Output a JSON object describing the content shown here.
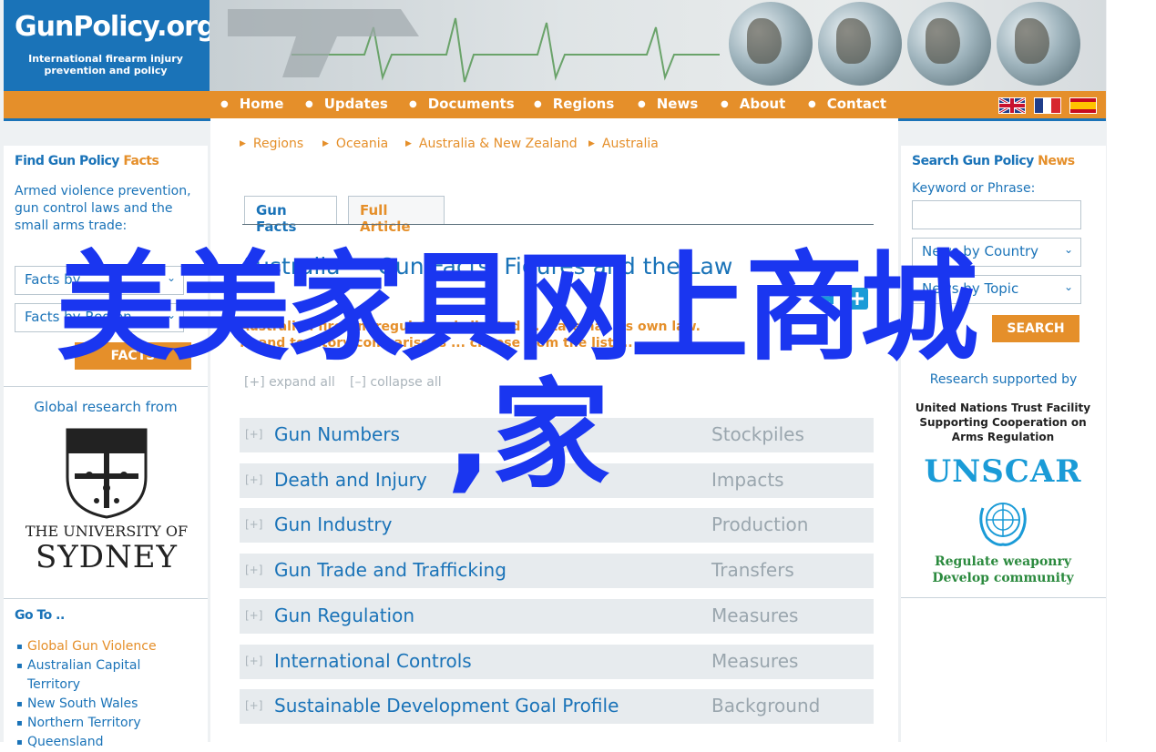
{
  "header": {
    "logo_title": "GunPolicy.org",
    "logo_sub_1": "International firearm injury",
    "logo_sub_2": "prevention and policy"
  },
  "nav": {
    "items": [
      "Home",
      "Updates",
      "Documents",
      "Regions",
      "News",
      "About",
      "Contact"
    ],
    "flags": [
      "uk-flag",
      "france-flag",
      "spain-flag"
    ]
  },
  "left": {
    "find_title_a": "Find Gun Policy",
    "find_title_b": "Facts",
    "find_text": "Armed violence prevention, gun control laws and the small arms trade:",
    "select_facts_by": "Facts by",
    "select_facts_region": "Facts by Region",
    "facts_button": "FACTS",
    "global_research": "Global research from",
    "uni_line1": "THE UNIVERSITY OF",
    "uni_line2": "SYDNEY",
    "goto_title": "Go To ..",
    "goto_items": [
      "Global Gun Violence",
      "Australian Capital Territory",
      "New South Wales",
      "Northern Territory",
      "Queensland"
    ]
  },
  "main": {
    "breadcrumbs": [
      "Regions",
      "Oceania",
      "Australia & New Zealand",
      "Australia"
    ],
    "tabs": [
      "Gun Facts",
      "Full Article"
    ],
    "title": "Australia — Gun Facts, Figures and the Law",
    "intro_1": "Australian firearm regulation is limited ... state has its own law.",
    "intro_2": "... and territory comparisons ... choose from the list ...",
    "expand_all": "[+] expand all",
    "collapse_all": "[–] collapse all",
    "rows": [
      {
        "title": "Gun Numbers",
        "sub": "Stockpiles"
      },
      {
        "title": "Death and Injury",
        "sub": "Impacts"
      },
      {
        "title": "Gun Industry",
        "sub": "Production"
      },
      {
        "title": "Gun Trade and Trafficking",
        "sub": "Transfers"
      },
      {
        "title": "Gun Regulation",
        "sub": "Measures"
      },
      {
        "title": "International Controls",
        "sub": "Measures"
      },
      {
        "title": "Sustainable Development Goal Profile",
        "sub": "Background"
      }
    ],
    "row_plus": "[+]"
  },
  "right": {
    "search_title_a": "Search Gun Policy",
    "search_title_b": "News",
    "keyword_label": "Keyword or Phrase:",
    "keyword_value": "",
    "news_by_country": "News by Country",
    "news_by_topic": "News by Topic",
    "search_button": "SEARCH",
    "research_supported": "Research supported by",
    "un_1": "United Nations Trust Facility",
    "un_2": "Supporting Cooperation on",
    "un_3": "Arms Regulation",
    "unscar": "UNSCAR",
    "green_1": "Regulate weaponry",
    "green_2": "Develop community"
  },
  "overlay": {
    "line1": "美美家具网上商城",
    "line2": ",家"
  },
  "colors": {
    "brand_blue": "#1a73b8",
    "nav_orange": "#e58f2a",
    "overlay_blue": "#1a36f0"
  }
}
